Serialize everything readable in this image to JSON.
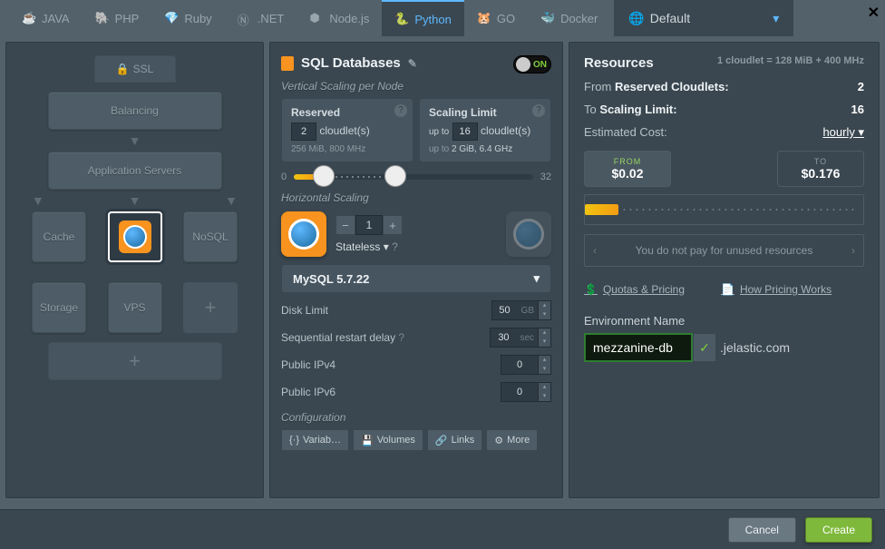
{
  "tabs": {
    "java": "JAVA",
    "php": "PHP",
    "ruby": "Ruby",
    "dotnet": ".NET",
    "node": "Node.js",
    "python": "Python",
    "go": "GO",
    "docker": "Docker"
  },
  "region": {
    "label": "Default"
  },
  "topology": {
    "ssl": "SSL",
    "balancing": "Balancing",
    "application_servers": "Application Servers",
    "cache": "Cache",
    "nosql": "NoSQL",
    "storage": "Storage",
    "vps": "VPS"
  },
  "sql": {
    "title": "SQL Databases",
    "toggle": "ON",
    "vscale_label": "Vertical Scaling per Node",
    "reserved": {
      "title": "Reserved",
      "value": "2",
      "unit": "cloudlet(s)",
      "sub": "256 MiB, 800 MHz"
    },
    "limit": {
      "title": "Scaling Limit",
      "prefix": "up to",
      "value": "16",
      "unit": "cloudlet(s)",
      "sub_prefix": "up to",
      "sub": "2 GiB, 6.4 GHz"
    },
    "slider": {
      "min": "0",
      "max": "32"
    },
    "hscale_label": "Horizontal Scaling",
    "hscale_count": "1",
    "hscale_mode": "Stateless",
    "stack": "MySQL 5.7.22",
    "disk_limit": {
      "label": "Disk Limit",
      "value": "50",
      "unit": "GB"
    },
    "restart": {
      "label": "Sequential restart delay",
      "value": "30",
      "unit": "sec"
    },
    "ipv4": {
      "label": "Public IPv4",
      "value": "0"
    },
    "ipv6": {
      "label": "Public IPv6",
      "value": "0"
    },
    "config_label": "Configuration",
    "btn_vars": "Variab…",
    "btn_volumes": "Volumes",
    "btn_links": "Links",
    "btn_more": "More"
  },
  "resources": {
    "title": "Resources",
    "hint": "1 cloudlet = 128 MiB + 400 MHz",
    "from_label": "From",
    "reserved_label": "Reserved Cloudlets:",
    "reserved_val": "2",
    "to_label": "To",
    "limit_label": "Scaling Limit:",
    "limit_val": "16",
    "est_label": "Estimated Cost:",
    "period": "hourly",
    "from_box_label": "FROM",
    "from_cost": "$0.02",
    "to_box_label": "TO",
    "to_cost": "$0.176",
    "pay_msg": "You do not pay for unused resources",
    "link_quotas": "Quotas & Pricing",
    "link_how": "How Pricing Works",
    "env_label": "Environment Name",
    "env_value": "mezzanine-db",
    "env_domain": ".jelastic.com"
  },
  "footer": {
    "cancel": "Cancel",
    "create": "Create"
  }
}
